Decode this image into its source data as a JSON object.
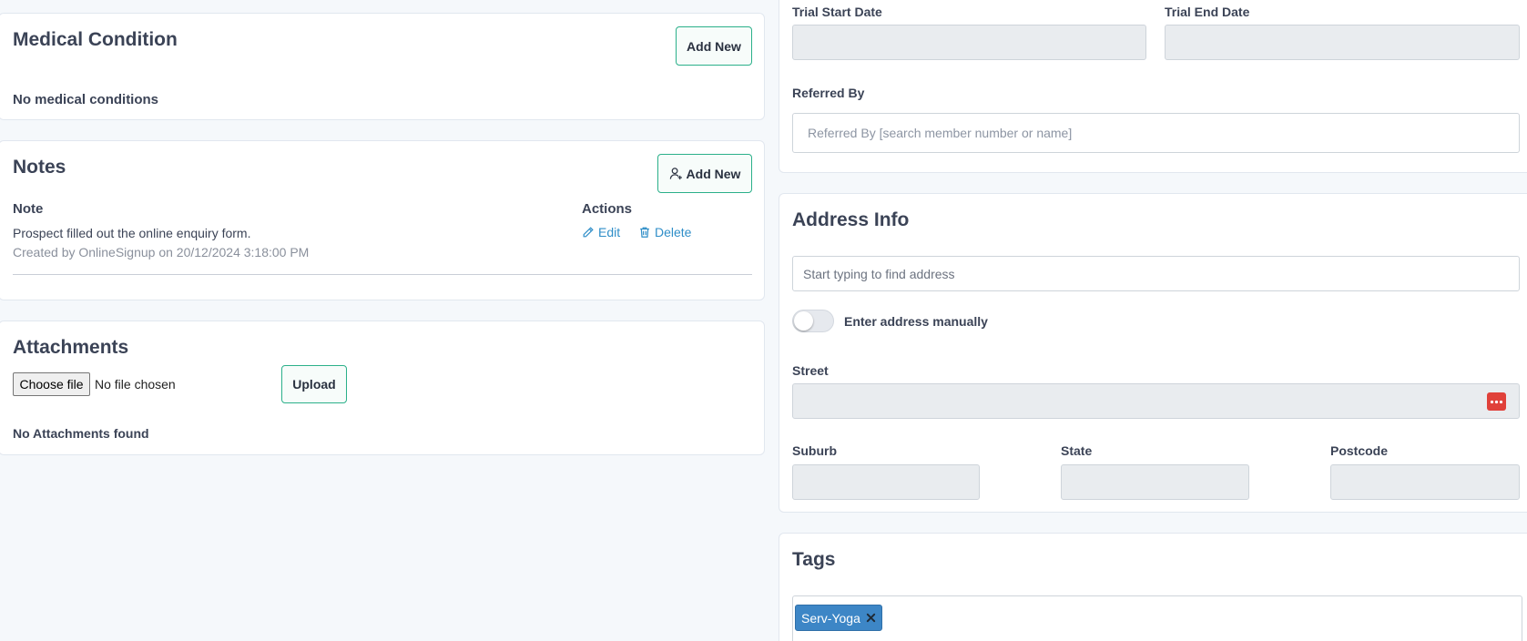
{
  "medical": {
    "title": "Medical Condition",
    "add_label": "Add New",
    "empty_text": "No medical conditions"
  },
  "notes": {
    "title": "Notes",
    "add_label": "Add New",
    "col_note": "Note",
    "col_actions": "Actions",
    "rows": [
      {
        "text": "Prospect filled out the online enquiry form.",
        "meta": "Created by OnlineSignup on 20/12/2024 3:18:00 PM",
        "edit_label": "Edit",
        "delete_label": "Delete"
      }
    ]
  },
  "attachments": {
    "title": "Attachments",
    "choose_label": "Choose file",
    "file_status": "No file chosen",
    "upload_label": "Upload",
    "empty_text": "No Attachments found"
  },
  "trial": {
    "start_label": "Trial Start Date",
    "end_label": "Trial End Date",
    "start_value": "",
    "end_value": "",
    "referred_label": "Referred By",
    "referred_placeholder": "Referred By [search member number or name]"
  },
  "address": {
    "title": "Address Info",
    "search_placeholder": "Start typing to find address",
    "manual_toggle_label": "Enter address manually",
    "manual_toggle_on": false,
    "street_label": "Street",
    "suburb_label": "Suburb",
    "state_label": "State",
    "postcode_label": "Postcode",
    "street_value": "",
    "suburb_value": "",
    "state_value": "",
    "postcode_value": ""
  },
  "tags": {
    "title": "Tags",
    "items": [
      {
        "label": "Serv-Yoga"
      }
    ]
  },
  "colors": {
    "accent_green": "#2bb08a",
    "link_blue": "#2f8ec8",
    "tag_blue": "#3d86c6",
    "badge_red": "#e0413a"
  },
  "icons": {
    "add_note": "user-plus-icon",
    "edit": "pencil-icon",
    "delete": "trash-icon",
    "street_addon": "more-dots-icon",
    "tag_remove": "close-icon"
  }
}
